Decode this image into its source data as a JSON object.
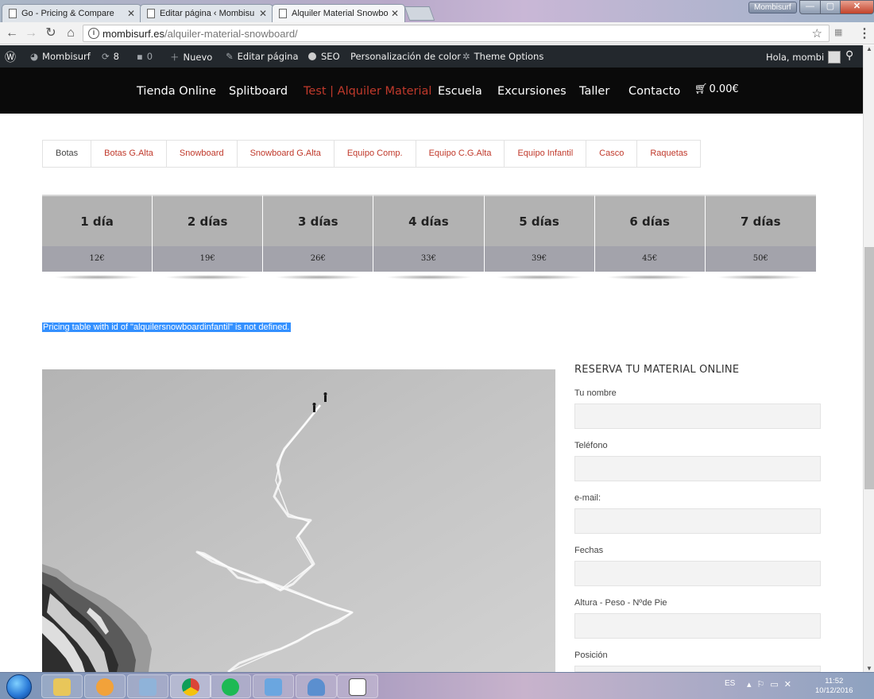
{
  "browser": {
    "tabs": [
      {
        "label": "Go - Pricing & Compare"
      },
      {
        "label": "Editar página ‹ Mombisu"
      },
      {
        "label": "Alquiler Material Snowbo"
      }
    ],
    "url_host": "mombisurf.es",
    "url_path": "/alquiler-material-snowboard/",
    "window_user": "Mombisurf"
  },
  "admin_bar": {
    "site_name": "Mombisurf",
    "updates_count": "8",
    "comments_count": "0",
    "new_label": "Nuevo",
    "edit_page_label": "Editar página",
    "seo_label": "SEO",
    "color_label": "Personalización de color",
    "theme_options_label": "Theme Options",
    "greeting": "Hola, mombi"
  },
  "site_nav": {
    "items": [
      "Tienda Online",
      "Splitboard",
      "Test | Alquiler Material",
      "Escuela",
      "Excursiones",
      "Taller",
      "Contacto"
    ],
    "cart_total": "0.00€"
  },
  "subtabs": [
    "Botas",
    "Botas G.Alta",
    "Snowboard",
    "Snowboard G.Alta",
    "Equipo Comp.",
    "Equipo C.G.Alta",
    "Equipo Infantil",
    "Casco",
    "Raquetas"
  ],
  "pricing": {
    "headers": [
      "1 día",
      "2 días",
      "3 días",
      "4 días",
      "5 días",
      "6 días",
      "7 días"
    ],
    "prices": [
      "12€",
      "19€",
      "26€",
      "33€",
      "39€",
      "45€",
      "50€"
    ]
  },
  "pricing_error": "Pricing table with id of \"alquilersnowboardinfantil\" is not defined.",
  "booking": {
    "title": "RESERVA TU MATERIAL ONLINE",
    "fields": [
      "Tu nombre",
      "Teléfono",
      "e-mail:",
      "Fechas",
      "Altura - Peso - Nºde Pie",
      "Posición"
    ]
  },
  "taskbar": {
    "language": "ES",
    "time": "11:52",
    "date": "10/12/2016"
  }
}
